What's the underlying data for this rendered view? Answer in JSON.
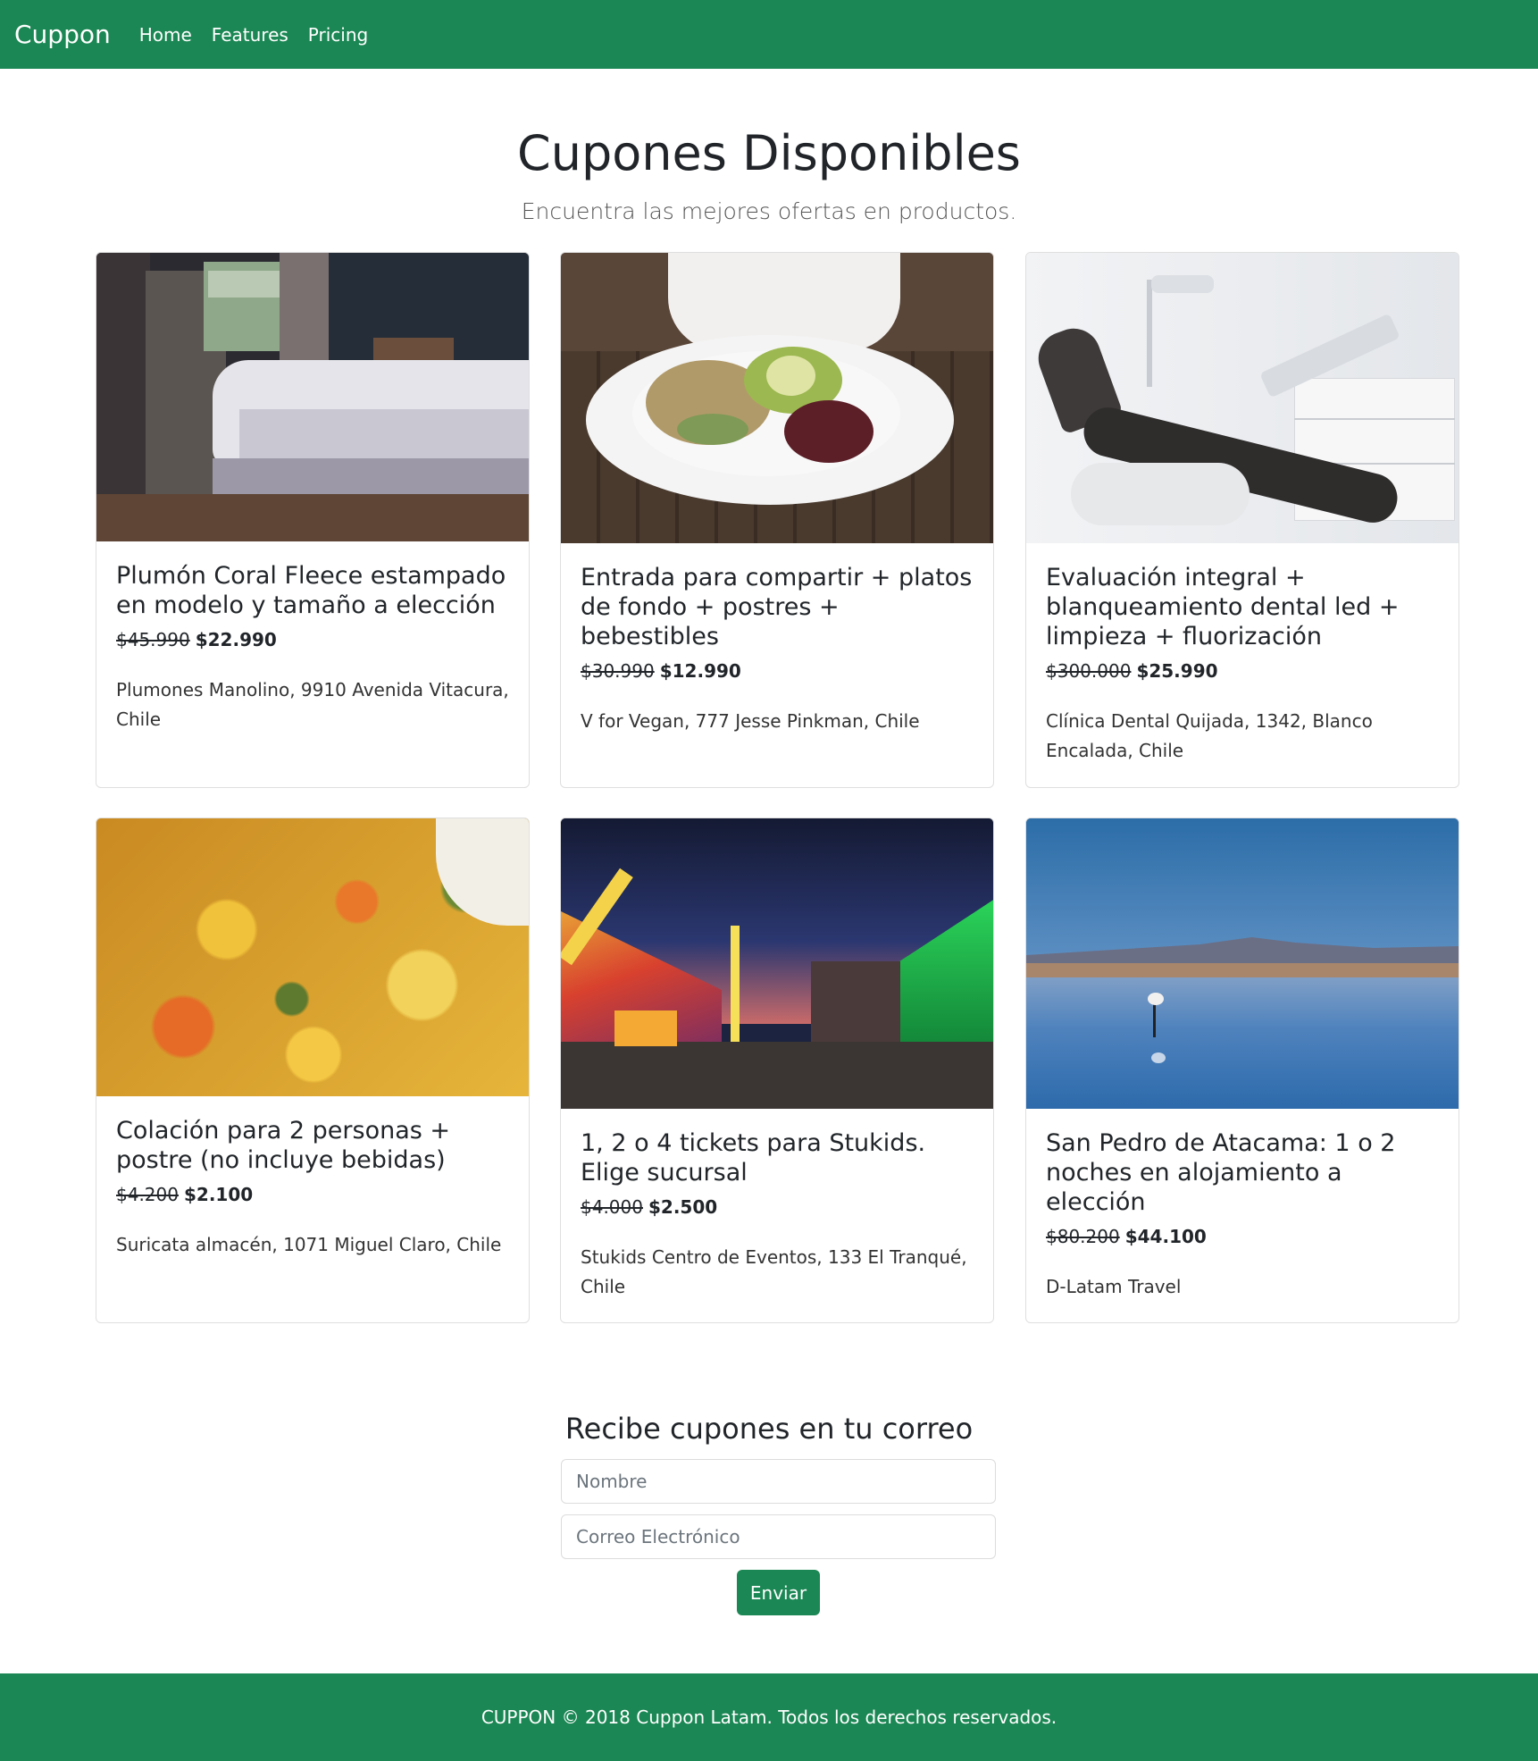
{
  "nav": {
    "brand": "Cuppon",
    "links": [
      "Home",
      "Features",
      "Pricing"
    ]
  },
  "header": {
    "title": "Cupones Disponibles",
    "subtitle": "Encuentra las mejores ofertas en productos."
  },
  "coupons": [
    {
      "image": "bedroom-photo",
      "title": "Plumón Coral Fleece estampado en modelo y tamaño a elección",
      "old_price": "$45.990",
      "new_price": "$22.990",
      "location": "Plumones Manolino, 9910 Avenida Vitacura, Chile"
    },
    {
      "image": "vegan-salad-photo",
      "title": "Entrada para compartir + platos de fondo + postres + bebestibles",
      "old_price": "$30.990",
      "new_price": "$12.990",
      "location": "V for Vegan, 777 Jesse Pinkman, Chile"
    },
    {
      "image": "dental-chair-photo",
      "title": "Evaluación integral + blanqueamiento dental led + limpieza + fluorización",
      "old_price": "$300.000",
      "new_price": "$25.990",
      "location": "Clínica Dental Quijada, 1342, Blanco Encalada, Chile"
    },
    {
      "image": "food-dish-photo",
      "title": "Colación para 2 personas + postre (no incluye bebidas)",
      "old_price": "$4.200",
      "new_price": "$2.100",
      "location": "Suricata almacén, 1071 Miguel Claro, Chile"
    },
    {
      "image": "amusement-park-photo",
      "title": "1, 2 o 4 tickets para Stukids. Elige sucursal",
      "old_price": "$4.000",
      "new_price": "$2.500",
      "location": "Stukids Centro de Eventos, 133 El Tranqué, Chile"
    },
    {
      "image": "flamingo-lake-photo",
      "title": "San Pedro de Atacama: 1 o 2 noches en alojamiento a elección",
      "old_price": "$80.200",
      "new_price": "$44.100",
      "location": "D-Latam Travel"
    }
  ],
  "newsletter": {
    "title": "Recibe cupones en tu correo",
    "name_placeholder": "Nombre",
    "email_placeholder": "Correo Electrónico",
    "submit_label": "Enviar"
  },
  "footer": {
    "text": "CUPPON © 2018 Cuppon Latam. Todos los derechos reservados."
  },
  "colors": {
    "brand_green": "#1b8754"
  }
}
